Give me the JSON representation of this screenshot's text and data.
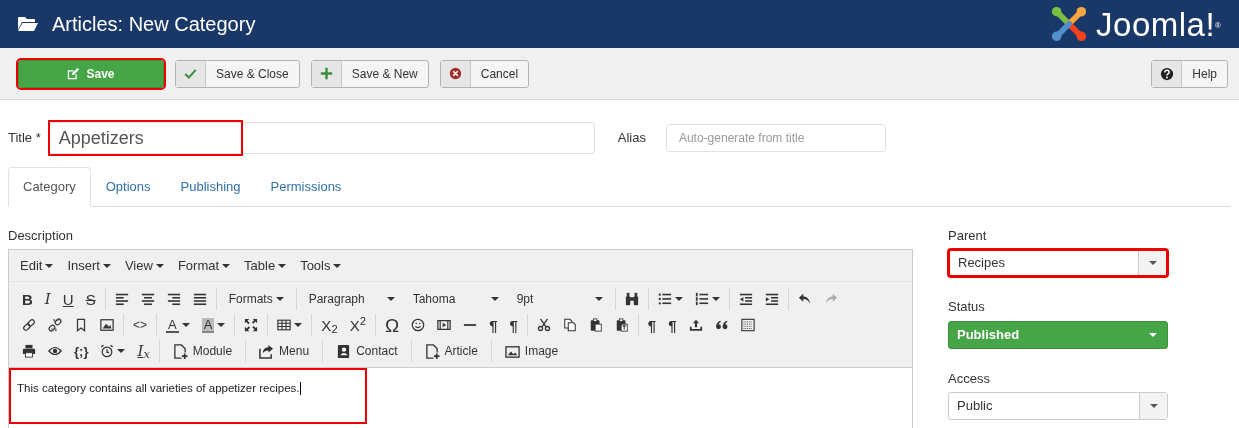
{
  "header": {
    "title": "Articles: New Category",
    "logo_text": "Joomla!",
    "logo_mark": "®"
  },
  "toolbar": {
    "buttons": [
      {
        "label": "Save",
        "kind": "primary",
        "highlighted": true
      },
      {
        "label": "Save & Close",
        "kind": "default",
        "highlighted": false
      },
      {
        "label": "Save & New",
        "kind": "default",
        "highlighted": false
      },
      {
        "label": "Cancel",
        "kind": "default",
        "highlighted": false
      }
    ],
    "help": {
      "label": "Help"
    }
  },
  "title_field": {
    "label": "Title",
    "required_mark": "*",
    "value": "Appetizers",
    "highlighted": true
  },
  "alias_field": {
    "label": "Alias",
    "placeholder": "Auto-generate from title"
  },
  "tabs": [
    {
      "label": "Category",
      "selected": true
    },
    {
      "label": "Options",
      "selected": false
    },
    {
      "label": "Publishing",
      "selected": false
    },
    {
      "label": "Permissions",
      "selected": false
    }
  ],
  "description": {
    "label": "Description",
    "highlighted": true,
    "menus": [
      "Edit",
      "Insert",
      "View",
      "Format",
      "Table",
      "Tools"
    ],
    "toolbar_rows": [
      [
        [
          {
            "kind": "bold",
            "text": "B",
            "disabled": false
          },
          {
            "kind": "italic",
            "text": "I",
            "disabled": false
          },
          {
            "kind": "underline",
            "text": "U",
            "disabled": false
          },
          {
            "kind": "strike",
            "text": "S",
            "disabled": false
          }
        ],
        [
          {
            "kind": "alignleft",
            "disabled": false
          },
          {
            "kind": "aligncenter",
            "disabled": false
          },
          {
            "kind": "alignright",
            "disabled": false
          },
          {
            "kind": "justify",
            "disabled": false
          }
        ],
        [
          {
            "kind": "menu",
            "text": "Formats",
            "disabled": false
          }
        ],
        [
          {
            "kind": "select",
            "text": "Paragraph",
            "disabled": false
          },
          {
            "kind": "select",
            "text": "Tahoma",
            "disabled": false
          },
          {
            "kind": "select",
            "text": "9pt",
            "disabled": false
          }
        ],
        [
          {
            "kind": "binoculars",
            "disabled": false
          }
        ],
        [
          {
            "kind": "bullets",
            "caret": true,
            "disabled": false
          },
          {
            "kind": "numbers",
            "caret": true,
            "disabled": false
          }
        ],
        [
          {
            "kind": "outdent",
            "disabled": false
          },
          {
            "kind": "indent",
            "disabled": false
          }
        ],
        [
          {
            "kind": "undo",
            "disabled": false
          },
          {
            "kind": "redo",
            "disabled": true
          }
        ]
      ],
      [
        [
          {
            "kind": "link",
            "disabled": false
          },
          {
            "kind": "unlink",
            "disabled": false
          },
          {
            "kind": "bookmark",
            "disabled": false
          },
          {
            "kind": "image",
            "disabled": false
          }
        ],
        [
          {
            "kind": "code",
            "text": "<>",
            "disabled": false
          }
        ],
        [
          {
            "kind": "forecolor",
            "text": "A",
            "caret": true,
            "disabled": false
          },
          {
            "kind": "backcolor",
            "text": "A",
            "caret": true,
            "disabled": false
          }
        ],
        [
          {
            "kind": "fullscreen",
            "disabled": false
          }
        ],
        [
          {
            "kind": "table",
            "caret": true,
            "disabled": false
          }
        ],
        [
          {
            "kind": "script",
            "text": "X$_{2}$",
            "disabled": false
          },
          {
            "kind": "script",
            "text": "X$^{2}$",
            "disabled": false
          }
        ],
        [
          {
            "kind": "symbol",
            "text": "Ω",
            "disabled": false
          },
          {
            "kind": "emoji",
            "disabled": false
          },
          {
            "kind": "media",
            "disabled": false
          },
          {
            "kind": "rule",
            "disabled": false
          },
          {
            "kind": "pilcrow",
            "text": "¶",
            "disabled": false
          },
          {
            "kind": "pilcrow",
            "text": "¶",
            "disabled": false
          }
        ],
        [
          {
            "kind": "cut",
            "disabled": false
          },
          {
            "kind": "copy",
            "disabled": false
          },
          {
            "kind": "paste",
            "disabled": false
          },
          {
            "kind": "pastetext",
            "disabled": false
          }
        ],
        [
          {
            "kind": "pilcrow",
            "text": "¶",
            "disabled": false
          },
          {
            "kind": "pilcrow",
            "text": "¶",
            "disabled": false
          },
          {
            "kind": "upload",
            "disabled": false
          },
          {
            "kind": "quote",
            "disabled": false
          },
          {
            "kind": "template",
            "disabled": false
          }
        ]
      ],
      [
        [
          {
            "kind": "print",
            "disabled": false
          },
          {
            "kind": "eye",
            "disabled": false
          },
          {
            "kind": "braces",
            "text": "{;}",
            "disabled": false
          },
          {
            "kind": "clock",
            "caret": true,
            "disabled": false
          },
          {
            "kind": "clear",
            "text": "I$_{x}$",
            "disabled": false
          }
        ],
        [
          {
            "kind": "pageinsert",
            "text": "Module",
            "disabled": false
          }
        ],
        [
          {
            "kind": "shareinsert",
            "text": "Menu",
            "disabled": false
          }
        ],
        [
          {
            "kind": "contactinsert",
            "text": "Contact",
            "disabled": false
          }
        ],
        [
          {
            "kind": "pageinsert",
            "text": "Article",
            "disabled": false
          }
        ],
        [
          {
            "kind": "pictureinsert",
            "text": "Image",
            "disabled": false
          }
        ]
      ]
    ],
    "content": "This category contains all varieties of appetizer recipes."
  },
  "sidebar": {
    "fields": [
      {
        "label": "Parent",
        "value": "Recipes",
        "kind": "select",
        "highlighted": true
      },
      {
        "label": "Status",
        "value": "Published",
        "kind": "status",
        "highlighted": false
      },
      {
        "label": "Access",
        "value": "Public",
        "kind": "select",
        "highlighted": false
      }
    ]
  }
}
